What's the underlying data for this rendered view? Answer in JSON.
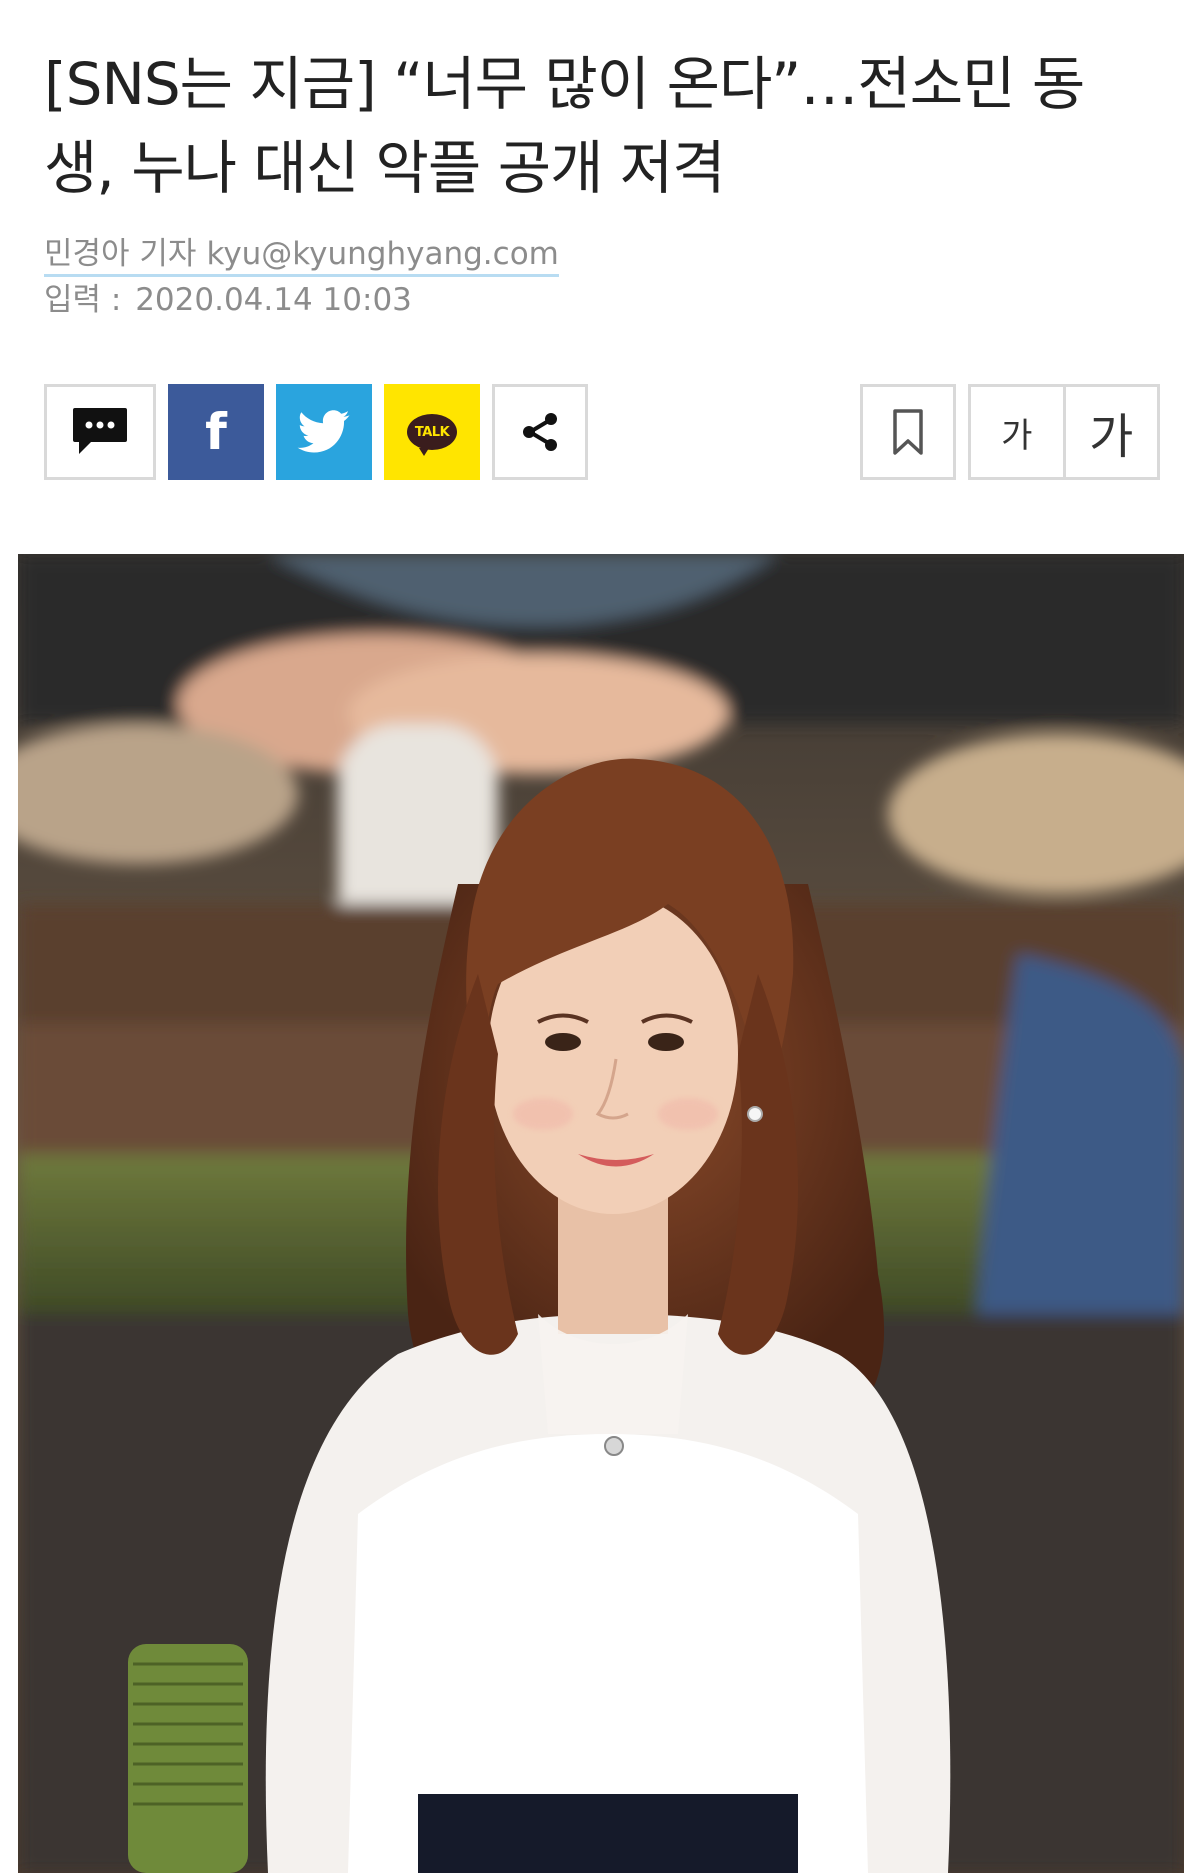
{
  "article": {
    "title": "[SNS는 지금] “너무 많이 온다”…전소민 동생, 누나 대신 악플 공개 저격",
    "reporter": "민경아 기자",
    "email": "kyu@kyunghyang.com",
    "date_label": "입력 :",
    "date_value": "2020.04.14 10:03"
  },
  "share_bar": {
    "comment_icon": "speech-bubble-icon",
    "facebook_icon": "facebook-icon",
    "twitter_icon": "twitter-bird-icon",
    "kakao_label": "TALK",
    "share_icon": "share-icon",
    "brand_colors": {
      "facebook": "#3c5a9a",
      "twitter": "#2aa4de",
      "kakao": "#ffe500"
    }
  },
  "tools": {
    "bookmark_icon": "bookmark-icon",
    "font_small_label": "가",
    "font_large_label": "가"
  }
}
